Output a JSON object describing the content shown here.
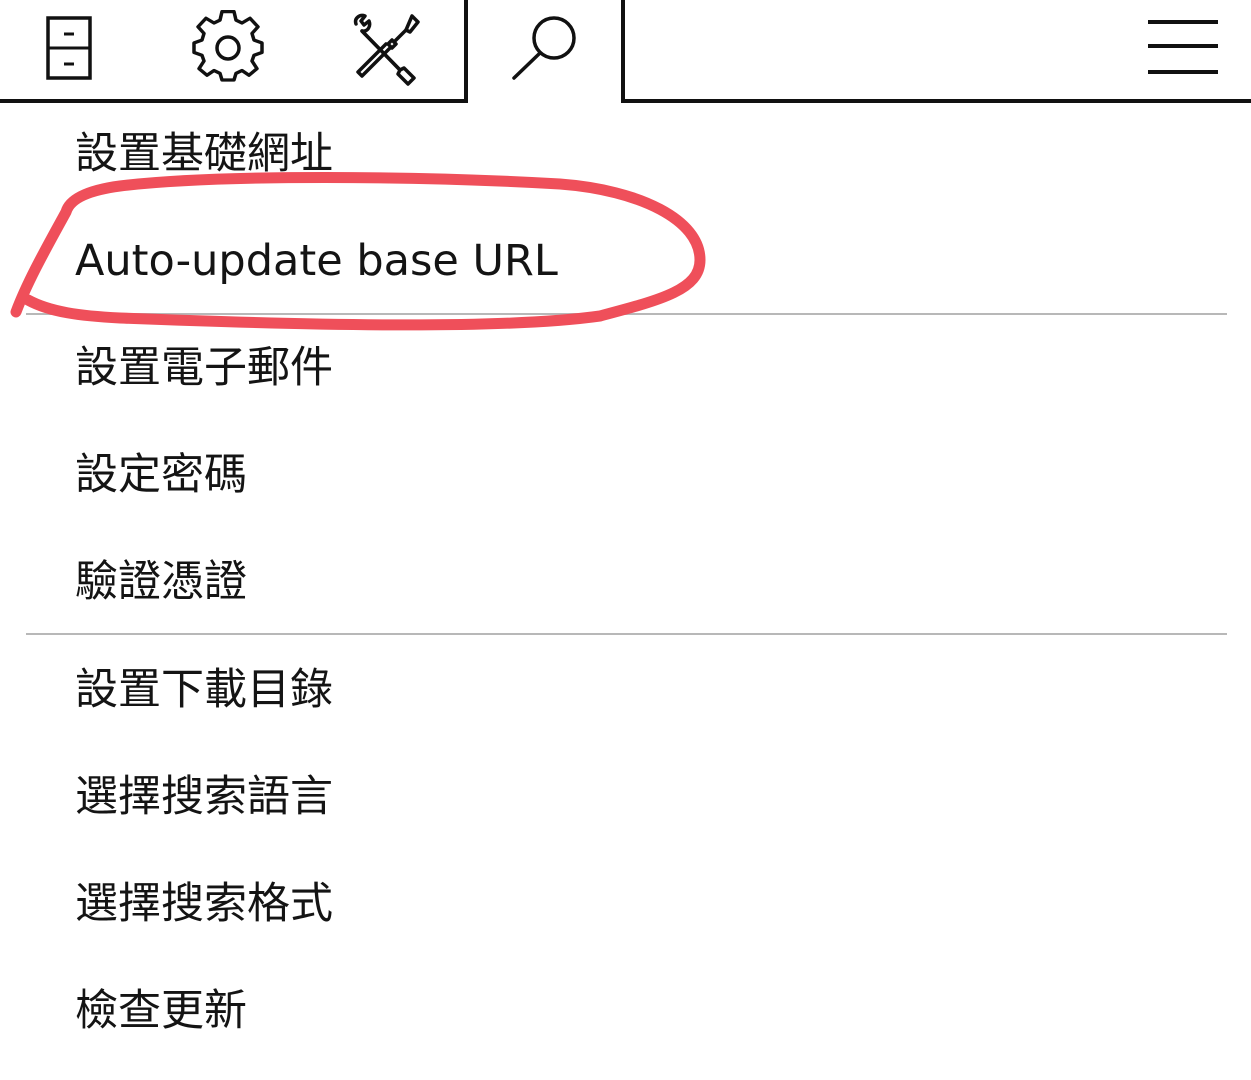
{
  "toolbar": {
    "tabs": [
      {
        "name": "library",
        "icon": "filing-cabinet-icon",
        "active": false
      },
      {
        "name": "settings",
        "icon": "gear-icon",
        "active": false
      },
      {
        "name": "tools",
        "icon": "wrench-screwdriver-icon",
        "active": false
      },
      {
        "name": "search",
        "icon": "magnifier-icon",
        "active": true
      }
    ],
    "menu_icon": "hamburger-menu-icon"
  },
  "menu": {
    "group1": [
      {
        "label": "設置基礎網址"
      },
      {
        "label": "Auto-update base URL"
      }
    ],
    "group2": [
      {
        "label": "設置電子郵件"
      },
      {
        "label": "設定密碼"
      },
      {
        "label": "驗證憑證"
      }
    ],
    "group3": [
      {
        "label": "設置下載目錄"
      },
      {
        "label": "選擇搜索語言"
      },
      {
        "label": "選擇搜索格式"
      },
      {
        "label": "檢查更新"
      }
    ]
  },
  "colors": {
    "text": "#141414",
    "divider": "#b8b8b8",
    "frame": "#111111",
    "annotation": "#ef4f5a"
  },
  "annotation": {
    "shape": "freehand-ellipse",
    "highlights": "Auto-update base URL"
  }
}
